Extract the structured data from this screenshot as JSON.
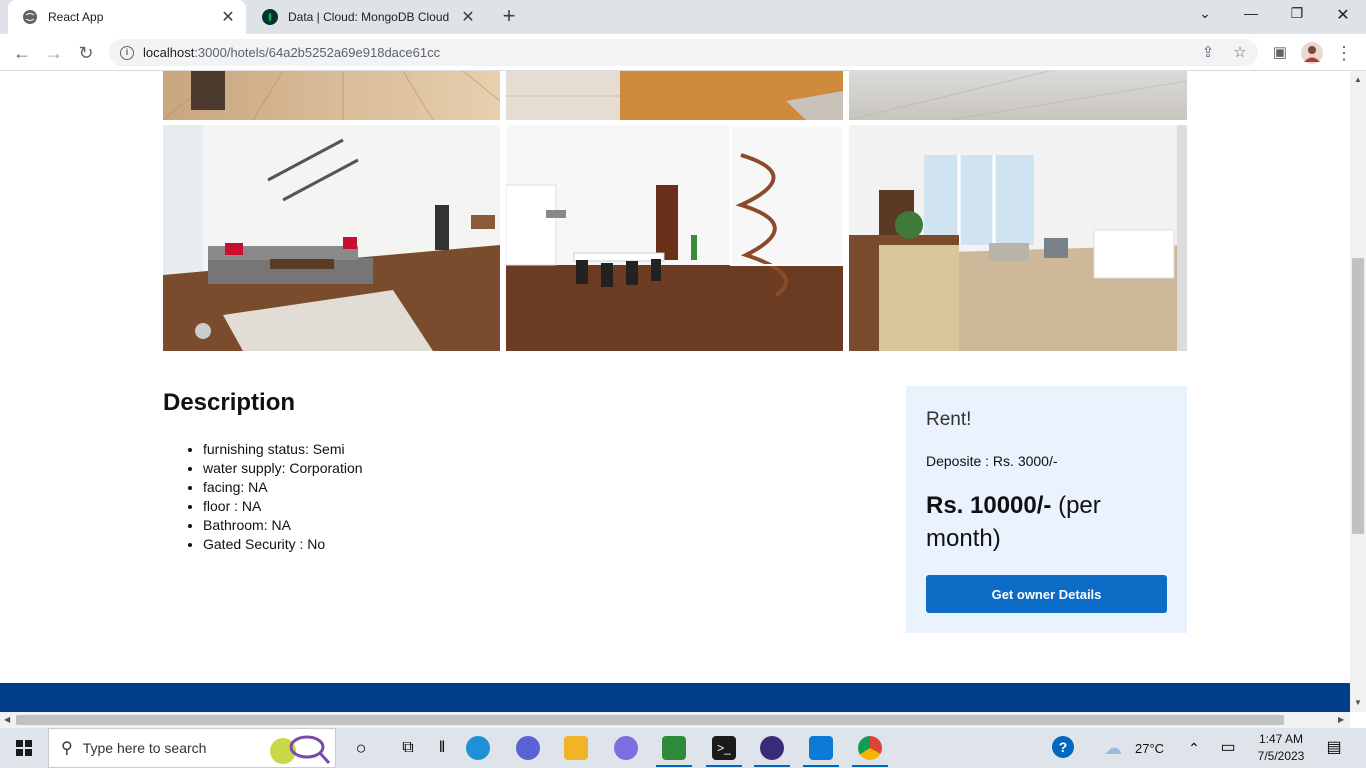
{
  "browser": {
    "tabs": [
      {
        "title": "React App",
        "active": true
      },
      {
        "title": "Data | Cloud: MongoDB Cloud",
        "active": false
      }
    ],
    "url_host": "localhost",
    "url_rest": ":3000/hotels/64a2b5252a69e918dace61cc"
  },
  "listing": {
    "description_heading": "Description",
    "features": [
      "furnishing status: Semi",
      "water supply: Corporation",
      "facing: NA",
      "floor : NA",
      "Bathroom: NA",
      "Gated Security : No"
    ],
    "rent_heading": "Rent!",
    "deposit": "Deposite : Rs. 3000/-",
    "price": "Rs. 10000/-",
    "price_suffix": " (per month)",
    "owner_button": "Get owner Details"
  },
  "taskbar": {
    "search_placeholder": "Type here to search",
    "temperature": "27°C",
    "time": "1:47 AM",
    "date": "7/5/2023"
  },
  "colors": {
    "footer": "#003e8a",
    "button": "#0b6bc5",
    "rent_box": "#eaf2fd"
  }
}
